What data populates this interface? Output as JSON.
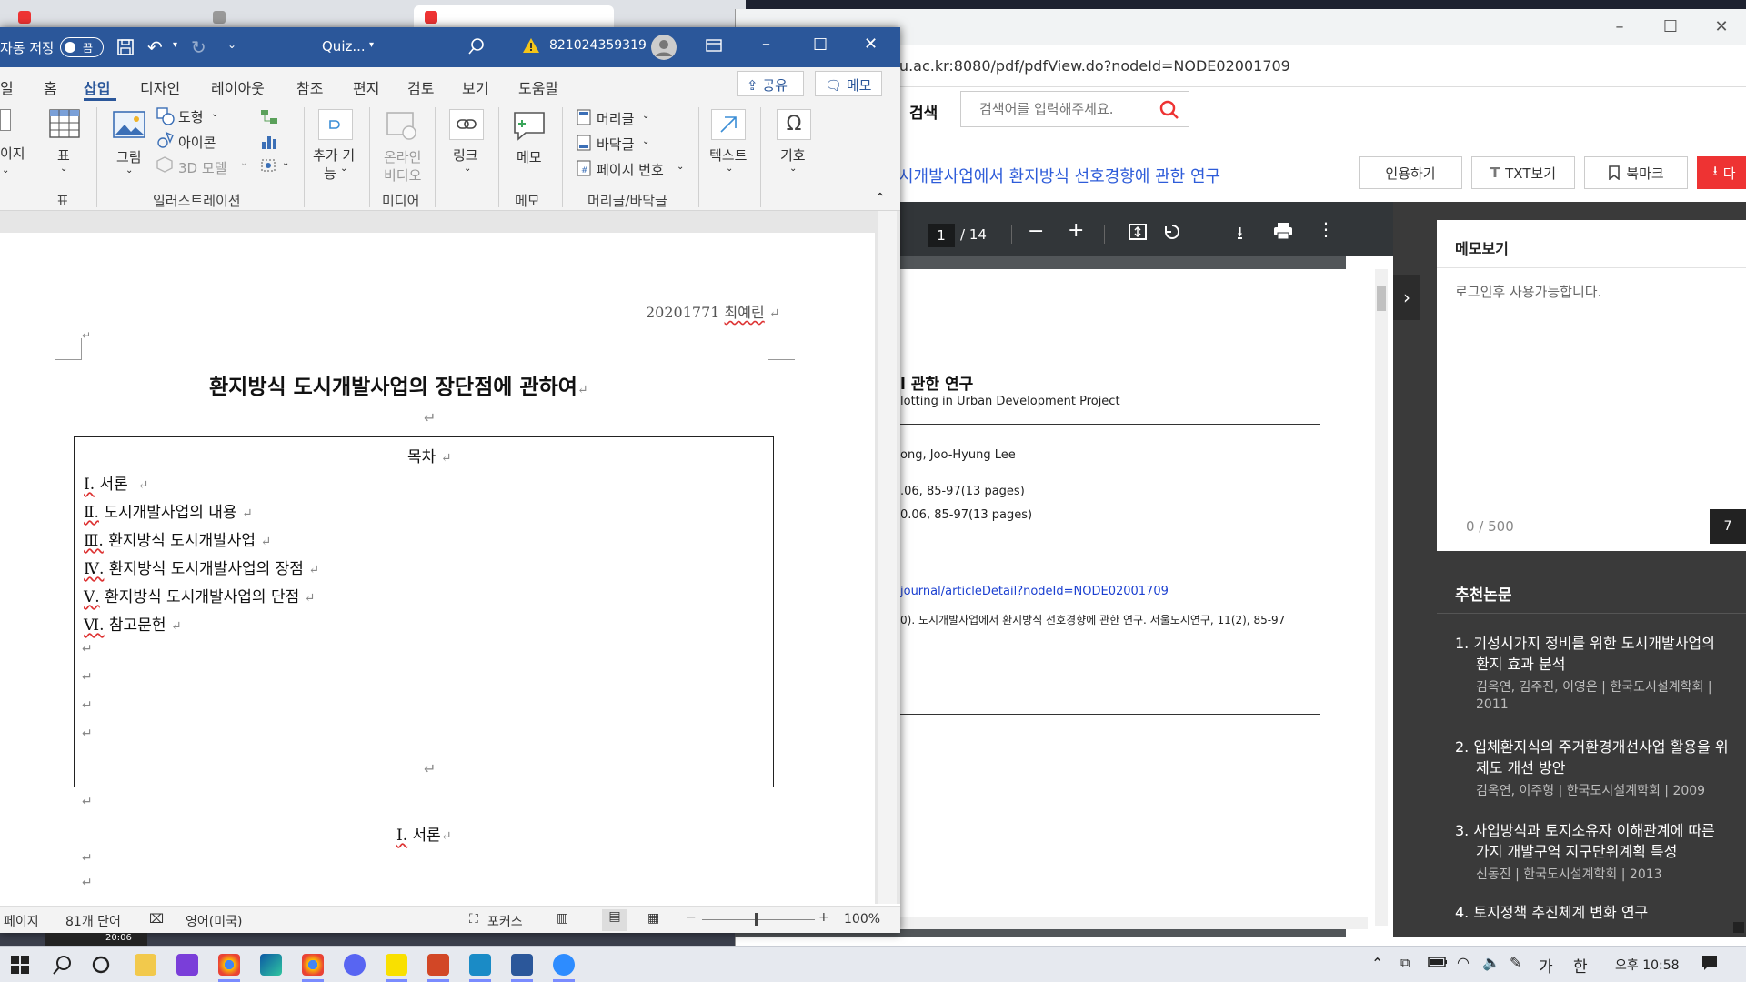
{
  "background_tabs": {
    "tab1": "",
    "tab2": "",
    "tab3": ""
  },
  "chrome": {
    "window_title": "",
    "url": "a.co.kr.ssl.openlink.ssu.ac.kr:8080/pdf/pdfView.do?nodeId=NODE02001709",
    "search_label": "검색",
    "search_placeholder": "검색어를 입력해주세요.",
    "paper_title": "시개발사업에서 환지방식 선호경향에 관한 연구",
    "buttons": {
      "cite": "인용하기",
      "txt": "TXT보기",
      "bookmark": "북마크",
      "download": "다"
    },
    "pdf": {
      "page_current": "1",
      "page_total": "/ 14",
      "heading_fragment": "l 관한 연구",
      "subtitle_fragment": "lotting in Urban Development Project",
      "authors_fragment": "ong, Joo-Hyung Lee",
      "line1": ".06, 85-97(13 pages)",
      "line2": "0.06, 85-97(13 pages)",
      "link": "journal/articleDetail?nodeId=NODE02001709",
      "citation": "0). 도시개발사업에서 환지방식 선호경향에 관한 연구. 서울도시연구, 11(2), 85-97"
    },
    "memo": {
      "title": "메모보기",
      "placeholder": "로그인후 사용가능합니다.",
      "counter": "0 / 500",
      "save_fragment": "7"
    },
    "recommend": {
      "title": "추천논문",
      "items": [
        {
          "num": "1.",
          "line1": "기성시가지 정비를 위한 도시개발사업의",
          "line2": "환지 효과 분석",
          "meta": "김옥연, 김주진, 이영은 | 한국도시설계학회 |",
          "meta2": "2011"
        },
        {
          "num": "2.",
          "line1": "입체환지식의 주거환경개선사업 활용을 위",
          "line2": "제도 개선 방안",
          "meta": "김옥연, 이주형 | 한국도시설계학회 | 2009",
          "meta2": ""
        },
        {
          "num": "3.",
          "line1": "사업방식과 토지소유자 이해관계에 따른",
          "line2": "가지 개발구역 지구단위계획 특성",
          "meta": "신동진 | 한국도시설계학회 | 2013",
          "meta2": ""
        },
        {
          "num": "4.",
          "line1": "토지정책 추진체계 변화 연구",
          "line2": "",
          "meta": "",
          "meta2": ""
        }
      ]
    }
  },
  "word": {
    "autosave": "자동 저장",
    "autosave_state": "끔",
    "doc_name": "Quiz...",
    "user_id": "821024359319",
    "tabs": [
      "일",
      "홈",
      "삽입",
      "디자인",
      "레이아웃",
      "참조",
      "편지",
      "검토",
      "보기",
      "도움말"
    ],
    "share": "공유",
    "memo_btn": "메모",
    "ribbon": {
      "page": "이지",
      "table": "표",
      "pictures": "그림",
      "shapes": "도형",
      "icons": "아이콘",
      "models": "3D 모델",
      "addins_1": "추가 기",
      "addins_2": "능",
      "online_video_1": "온라인",
      "online_video_2": "비디오",
      "link": "링크",
      "comment": "메모",
      "header": "머리글",
      "footer": "바닥글",
      "page_number": "페이지 번호",
      "text": "텍스트",
      "symbols": "기호",
      "groups": {
        "table": "표",
        "illustrations": "일러스트레이션",
        "media": "미디어",
        "comments": "메모",
        "headerfooter": "머리글/바닥글"
      }
    },
    "document": {
      "header_id": "20201771",
      "header_name": "최예린",
      "title": "환지방식 도시개발사업의 장단점에 관하여",
      "toc_title": "목차",
      "toc": [
        {
          "num": "Ⅰ.",
          "text": "서론"
        },
        {
          "num": "Ⅱ.",
          "text": "도시개발사업의 내용"
        },
        {
          "num": "Ⅲ.",
          "text": "환지방식 도시개발사업"
        },
        {
          "num": "Ⅳ.",
          "text": "환지방식 도시개발사업의 장점"
        },
        {
          "num": "Ⅴ.",
          "text": "환지방식 도시개발사업의 단점"
        },
        {
          "num": "Ⅵ.",
          "text": "참고문헌"
        }
      ],
      "section1_num": "Ⅰ.",
      "section1_title": "서론",
      "para_mark": "↵"
    },
    "status": {
      "page": "페이지",
      "words": "81개 단어",
      "language": "영어(미국)",
      "focus": "포커스",
      "zoom": "100%"
    }
  },
  "taskbar": {
    "time": "오후 10:58",
    "ime_lang": "가",
    "ime_mode": "한",
    "thumb_time": "20:06"
  }
}
